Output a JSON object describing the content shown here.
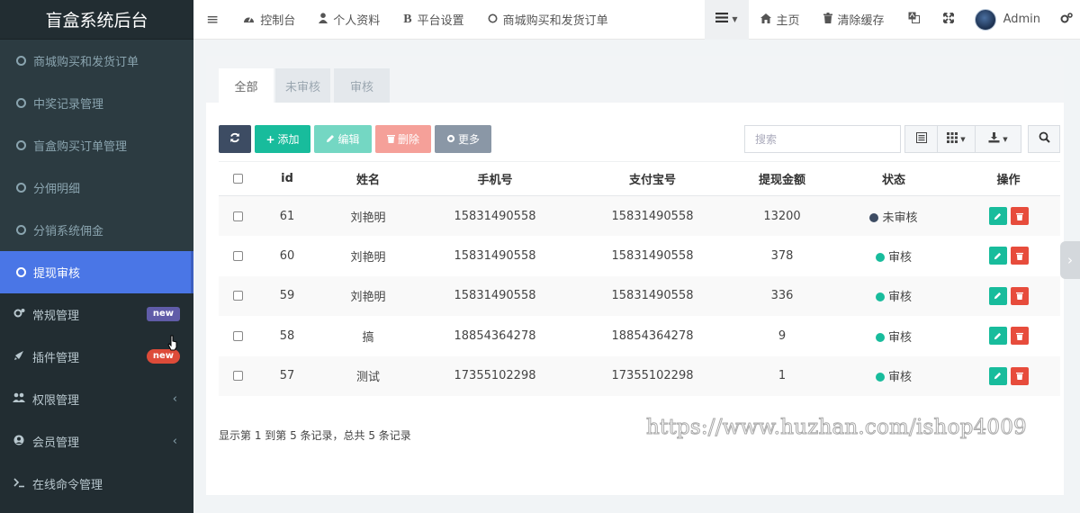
{
  "brand": "盲盒系统后台",
  "sidebar": {
    "sub_items": [
      {
        "label": "商城购买和发货订单"
      },
      {
        "label": "中奖记录管理"
      },
      {
        "label": "盲盒购买订单管理"
      },
      {
        "label": "分佣明细"
      },
      {
        "label": "分销系统佣金"
      },
      {
        "label": "提现审核"
      }
    ],
    "top_items": [
      {
        "label": "常规管理",
        "icon": "cogs-icon",
        "badge": "new"
      },
      {
        "label": "插件管理",
        "icon": "rocket-icon",
        "badge": "new"
      },
      {
        "label": "权限管理",
        "icon": "users-icon",
        "chevron": "‹"
      },
      {
        "label": "会员管理",
        "icon": "user-circle-icon",
        "chevron": "‹"
      },
      {
        "label": "在线命令管理",
        "icon": "terminal-icon"
      }
    ]
  },
  "navbar": {
    "menu_toggle": "≡",
    "items": [
      {
        "label": "控制台",
        "icon": "dashboard-icon"
      },
      {
        "label": "个人资料",
        "icon": "user-icon"
      },
      {
        "label": "平台设置",
        "icon": "bold-b-icon"
      },
      {
        "label": "商城购买和发货订单",
        "icon": "circle-icon"
      }
    ],
    "right": [
      {
        "label": "主页",
        "icon": "home-icon"
      },
      {
        "label": "清除缓存",
        "icon": "trash-icon"
      }
    ],
    "user": "Admin"
  },
  "tabs": [
    {
      "label": "全部",
      "active": true
    },
    {
      "label": "未审核",
      "active": false
    },
    {
      "label": "审核",
      "active": false
    }
  ],
  "toolbar": {
    "add": "添加",
    "edit": "编辑",
    "delete": "删除",
    "more": "更多",
    "search_placeholder": "搜索"
  },
  "table": {
    "columns": [
      "id",
      "姓名",
      "手机号",
      "支付宝号",
      "提现金额",
      "状态",
      "操作"
    ],
    "rows": [
      {
        "id": "61",
        "name": "刘艳明",
        "phone": "15831490558",
        "alipay": "15831490558",
        "amount": "13200",
        "status": "未审核",
        "status_type": "pending"
      },
      {
        "id": "60",
        "name": "刘艳明",
        "phone": "15831490558",
        "alipay": "15831490558",
        "amount": "378",
        "status": "审核",
        "status_type": "ok"
      },
      {
        "id": "59",
        "name": "刘艳明",
        "phone": "15831490558",
        "alipay": "15831490558",
        "amount": "336",
        "status": "审核",
        "status_type": "ok"
      },
      {
        "id": "58",
        "name": "搞",
        "phone": "18854364278",
        "alipay": "18854364278",
        "amount": "9",
        "status": "审核",
        "status_type": "ok"
      },
      {
        "id": "57",
        "name": "测试",
        "phone": "17355102298",
        "alipay": "17355102298",
        "amount": "1",
        "status": "审核",
        "status_type": "ok"
      }
    ]
  },
  "pager_info": "显示第 1 到第 5 条记录，总共 5 条记录",
  "watermark": "https://www.huzhan.com/ishop4009",
  "colors": {
    "sidebar_bg": "#222d32",
    "active": "#4a76e6",
    "success": "#18bc9c",
    "danger": "#e74c3c",
    "pending_dot": "#3d4c63"
  }
}
